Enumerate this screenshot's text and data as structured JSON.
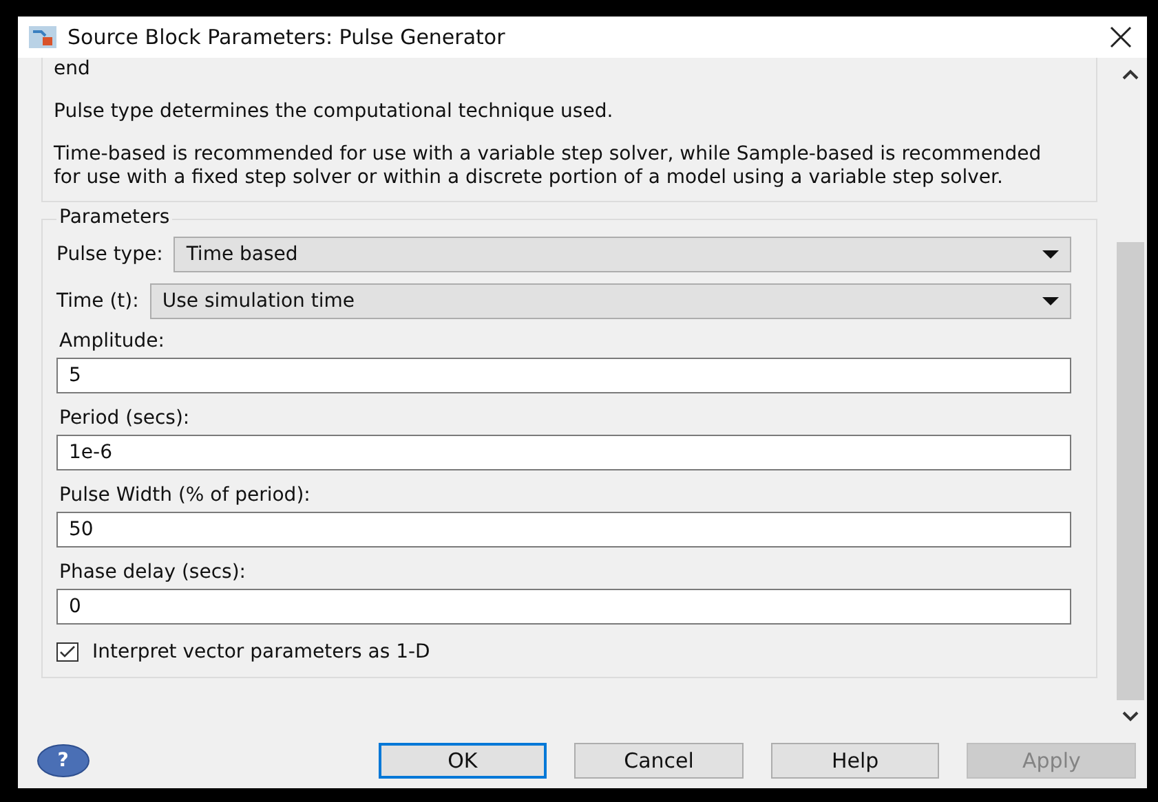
{
  "window": {
    "title": "Source Block Parameters: Pulse Generator"
  },
  "description": {
    "lines": [
      "end",
      "Pulse type determines the computational technique used.",
      "Time-based is recommended for use with a variable step solver, while Sample-based is recommended for use with a fixed step solver or within a discrete portion of a model using a variable step solver."
    ]
  },
  "parameters": {
    "title": "Parameters",
    "fields": [
      {
        "kind": "dropdown",
        "label": "Pulse type:",
        "value": "Time based"
      },
      {
        "kind": "dropdown",
        "label": "Time (t):",
        "value": "Use simulation time"
      },
      {
        "kind": "text",
        "label": "Amplitude:",
        "value": "5"
      },
      {
        "kind": "text",
        "label": "Period (secs):",
        "value": "1e-6"
      },
      {
        "kind": "text",
        "label": "Pulse Width (% of period):",
        "value": "50"
      },
      {
        "kind": "text",
        "label": "Phase delay (secs):",
        "value": "0"
      }
    ],
    "checkbox": {
      "label": "Interpret vector parameters as 1-D",
      "checked": true
    }
  },
  "help_button": {
    "label": "?"
  },
  "buttons": [
    {
      "label": "OK",
      "default": true,
      "disabled": false
    },
    {
      "label": "Cancel",
      "default": false,
      "disabled": false
    },
    {
      "label": "Help",
      "default": false,
      "disabled": false
    },
    {
      "label": "Apply",
      "default": false,
      "disabled": true
    }
  ]
}
